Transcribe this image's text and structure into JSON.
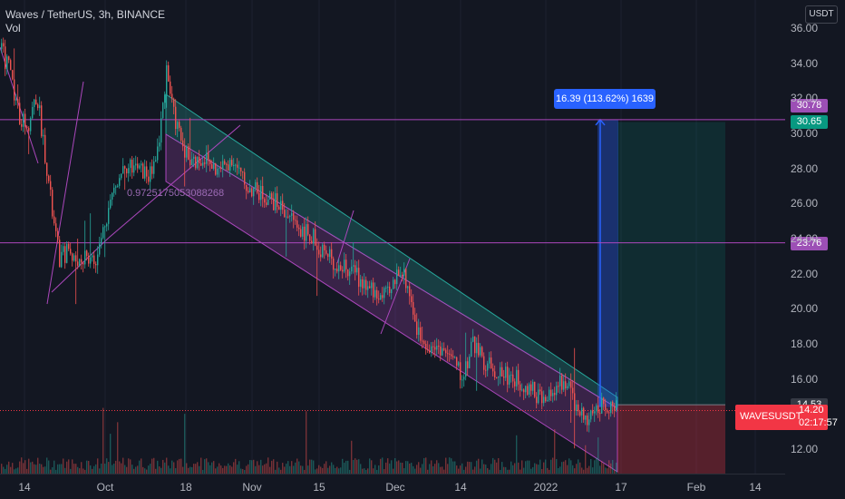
{
  "legend": {
    "symbol": "Waves / TetherUS, 3h, BINANCE",
    "indicator": "Vol"
  },
  "currency": "USDT",
  "watermark": "0.9725175053088268",
  "measure_label": "16.39 (113.62%) 1639",
  "symbol_tag": {
    "name": "WAVESUSDT",
    "price": "14.20",
    "countdown": "02:17:57"
  },
  "price_tags": [
    {
      "value": "30.78",
      "color": "#9c4fb5"
    },
    {
      "value": "30.65",
      "color": "#089981"
    },
    {
      "value": "23.76",
      "color": "#9c4fb5"
    },
    {
      "value": "14.53",
      "color": "#363a45"
    }
  ],
  "colors": {
    "bull": "#26a69a",
    "bear": "#ef5350",
    "line": "#ab47bc",
    "measure": "#2962ff"
  },
  "chart_data": {
    "type": "candlestick",
    "ylim": [
      10.6,
      36.8
    ],
    "y_ticks": [
      "36.00",
      "34.00",
      "32.00",
      "30.00",
      "28.00",
      "26.00",
      "24.00",
      "22.00",
      "20.00",
      "18.00",
      "16.00",
      "12.00"
    ],
    "x_ticks": [
      "14",
      "Oct",
      "18",
      "Nov",
      "15",
      "Dec",
      "14",
      "2022",
      "17",
      "Feb",
      "14"
    ],
    "horizontal_lines": [
      30.78,
      23.76
    ],
    "current_price": 14.2,
    "long_position": {
      "entry": 14.53,
      "target": 30.65,
      "stop": 10.7
    },
    "measure": {
      "from": 14.4,
      "to": 30.78,
      "change": 16.39,
      "percent": 113.62,
      "bars": 1639
    },
    "price_path": [
      [
        0,
        34.8
      ],
      [
        10,
        33.6
      ],
      [
        20,
        31.0
      ],
      [
        30,
        30.5
      ],
      [
        40,
        32.2
      ],
      [
        50,
        28.5
      ],
      [
        58,
        25.0
      ],
      [
        65,
        22.8
      ],
      [
        75,
        23.4
      ],
      [
        85,
        22.6
      ],
      [
        95,
        23.1
      ],
      [
        105,
        22.5
      ],
      [
        115,
        25.0
      ],
      [
        125,
        26.8
      ],
      [
        135,
        28.3
      ],
      [
        150,
        28.0
      ],
      [
        165,
        27.6
      ],
      [
        175,
        29.5
      ],
      [
        183,
        33.8
      ],
      [
        190,
        31.2
      ],
      [
        200,
        29.5
      ],
      [
        210,
        28.4
      ],
      [
        225,
        28.6
      ],
      [
        240,
        27.8
      ],
      [
        255,
        28.6
      ],
      [
        270,
        27.0
      ],
      [
        290,
        26.5
      ],
      [
        310,
        25.8
      ],
      [
        330,
        24.6
      ],
      [
        345,
        24.0
      ],
      [
        360,
        23.0
      ],
      [
        375,
        22.4
      ],
      [
        390,
        22.0
      ],
      [
        405,
        21.2
      ],
      [
        420,
        20.6
      ],
      [
        430,
        20.8
      ],
      [
        440,
        22.5
      ],
      [
        450,
        21.2
      ],
      [
        460,
        18.6
      ],
      [
        470,
        18.0
      ],
      [
        485,
        17.8
      ],
      [
        500,
        17.0
      ],
      [
        510,
        16.0
      ],
      [
        520,
        18.2
      ],
      [
        530,
        17.2
      ],
      [
        545,
        16.5
      ],
      [
        560,
        16.2
      ],
      [
        575,
        15.8
      ],
      [
        590,
        15.2
      ],
      [
        600,
        14.6
      ],
      [
        615,
        15.6
      ],
      [
        625,
        16.0
      ],
      [
        635,
        14.2
      ],
      [
        645,
        13.8
      ],
      [
        655,
        14.1
      ],
      [
        665,
        14.6
      ],
      [
        672,
        14.4
      ],
      [
        678,
        14.25
      ]
    ]
  }
}
